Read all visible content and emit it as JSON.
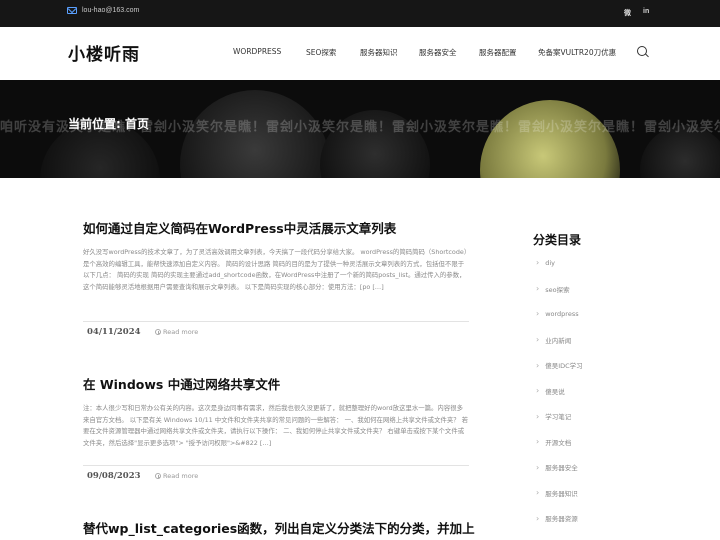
{
  "topbar": {
    "email": "lou-hao@163.com",
    "social": [
      {
        "label": "微",
        "icon": "weibo-icon"
      },
      {
        "label": "in",
        "icon": "linkedin-icon"
      }
    ]
  },
  "header": {
    "logo": "小楼听雨",
    "nav": [
      "WORDPRESS",
      "SEO探索",
      "服务器知识",
      "服务器安全",
      "服务器配置",
      "免备案VULTR20刀优惠"
    ]
  },
  "hero": {
    "breadcrumb": "当前位置: 首页",
    "ghost_text": "咱听没有汲笑尔是瞧！雷刽小汲笑尔是瞧！雷刽小汲笑尔是瞧！雷刽小汲笑尔是瞧！雷刽小汲笑尔是瞧！雷刽小汲笑尔是瞧！"
  },
  "posts": [
    {
      "title": "如何通过自定义简码在WordPress中灵活展示文章列表",
      "excerpt": "好久没写wordPress的技术文章了，为了灵活高效调用文章列表，今天搞了一段代码分享给大家。 wordPress的简码简码（Shortcode）是个高效的编辑工具，能帮快速添加自定义内容。 简码的设计思路 简码的目的是为了提供一种灵活展示文章列表的方式，包括但不限于以下几点： 简码的实现 简码的实现主要通过add_shortcode函数，在WordPress中注册了一个新的简码posts_list。通过传入的参数，这个简码能够灵活地根据用户需要查询和展示文章列表。 以下是简码实现的核心部分：使用方法：[po […]",
      "date": "04/11/2024",
      "read_more": "Read more"
    },
    {
      "title": "在 Windows 中通过网络共享文件",
      "excerpt": "注：本人很少写和日常办公有关的内容。这次是身边同事有需求，然后我也很久没更新了，就把整理好的word放这里水一篇。内容很多来自官方文档。 以下是有关 Windows 10/11 中文件和文件夹共享的常见问题的一些解答： 一、我如何在网络上共享文件或文件夹？ 若要在文件资源管理器中通过网络共享文件或文件夹，请执行以下操作： 二、我如何停止共享文件或文件夹？ 右键单击或按下某个文件或文件夹，然后选择\"显示更多选项\"> \"授予访问权限\">&#822 […]",
      "date": "09/08/2023",
      "read_more": "Read more"
    },
    {
      "title": "替代wp_list_categories函数，列出自定义分类法下的分类，并加上"
    }
  ],
  "sidebar": {
    "title": "分类目录",
    "categories": [
      "diy",
      "seo探索",
      "wordpress",
      "业内新闻",
      "傻吴IDC学习",
      "傻吴说",
      "学习笔记",
      "开源文档",
      "服务器安全",
      "服务器知识",
      "服务器资源"
    ]
  }
}
